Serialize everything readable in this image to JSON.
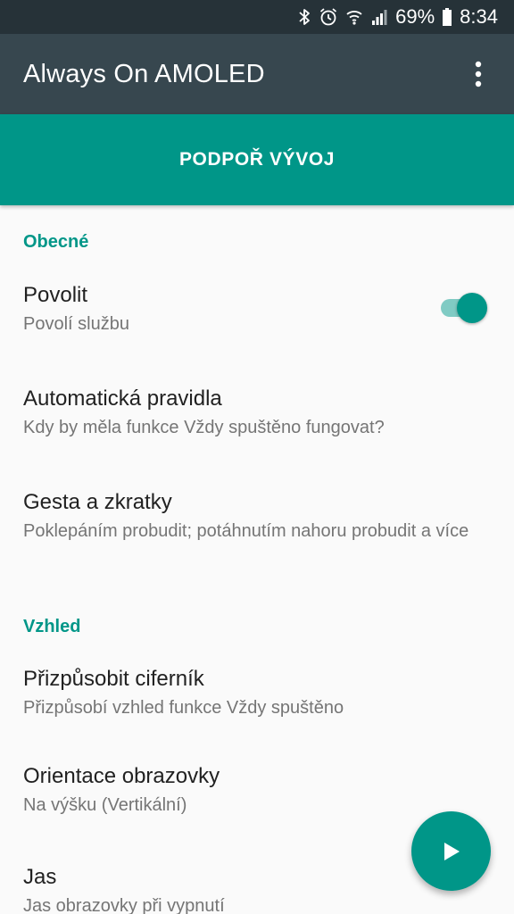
{
  "status_bar": {
    "battery": "69%",
    "time": "8:34",
    "icons": [
      "bluetooth-icon",
      "alarm-icon",
      "wifi-icon",
      "signal-icon",
      "battery-icon"
    ]
  },
  "app_bar": {
    "title": "Always On AMOLED",
    "menu_icon": "more-vert-icon"
  },
  "support_banner": {
    "label": "PODPOŘ VÝVOJ"
  },
  "sections": [
    {
      "header": "Obecné",
      "items": [
        {
          "title": "Povolit",
          "summary": "Povolí službu",
          "switch_on": true
        },
        {
          "title": "Automatická pravidla",
          "summary": "Kdy by měla funkce Vždy spuštěno fungovat?"
        },
        {
          "title": "Gesta a zkratky",
          "summary": "Poklepáním probudit; potáhnutím nahoru probudit a více"
        }
      ]
    },
    {
      "header": "Vzhled",
      "items": [
        {
          "title": "Přizpůsobit ciferník",
          "summary": "Přizpůsobí vzhled funkce Vždy spuštěno"
        },
        {
          "title": "Orientace obrazovky",
          "summary": "Na výšku (Vertikální)"
        },
        {
          "title": "Jas",
          "summary": "Jas obrazovky při vypnutí"
        }
      ]
    }
  ],
  "fab": {
    "icon": "play-icon"
  },
  "colors": {
    "accent": "#009688",
    "app_bar": "#37474f",
    "status_bar": "#263238",
    "background": "#fafafa"
  }
}
